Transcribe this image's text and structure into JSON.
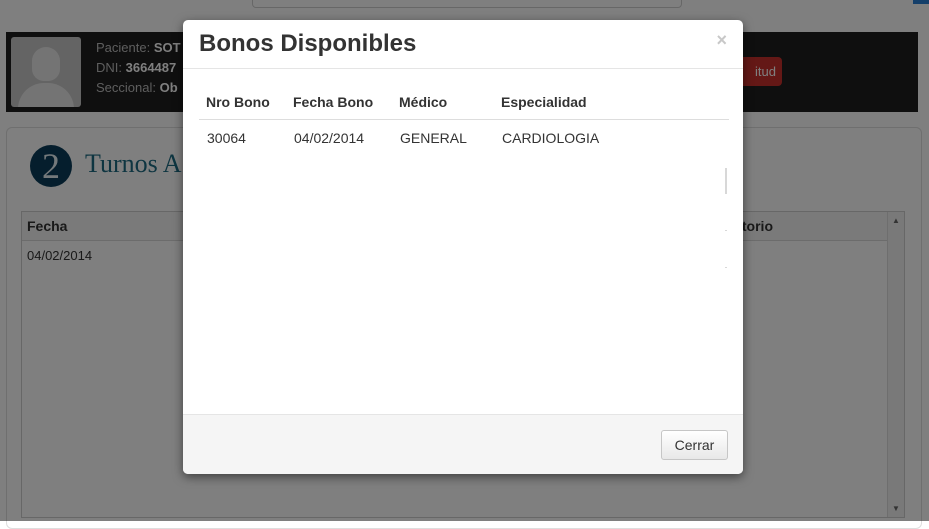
{
  "background": {
    "patient": {
      "paciente_label": "Paciente:",
      "paciente_value": "SOT",
      "dni_label": "DNI:",
      "dni_value": "3664487",
      "seccional_label": "Seccional:",
      "seccional_value": "Ob"
    },
    "request_button_label": "itud",
    "section": {
      "step_number": "2",
      "title": "Turnos A"
    },
    "grid": {
      "headers": [
        "Fecha",
        "ltorio"
      ],
      "rows": [
        {
          "fecha": "04/02/2014"
        }
      ]
    }
  },
  "modal": {
    "title": "Bonos Disponibles",
    "close_label": "×",
    "columns": [
      "Nro Bono",
      "Fecha Bono",
      "Médico",
      "Especialidad"
    ],
    "rows": [
      {
        "nro_bono": "30064",
        "fecha_bono": "04/02/2014",
        "medico": "GENERAL",
        "especialidad": "CARDIOLOGIA"
      }
    ],
    "close_button_label": "Cerrar"
  },
  "colors": {
    "patient_bar": "#1e1e1e",
    "title_teal": "#1c6b82",
    "step_badge": "#0a3d5a",
    "danger_button": "#c9302c"
  }
}
